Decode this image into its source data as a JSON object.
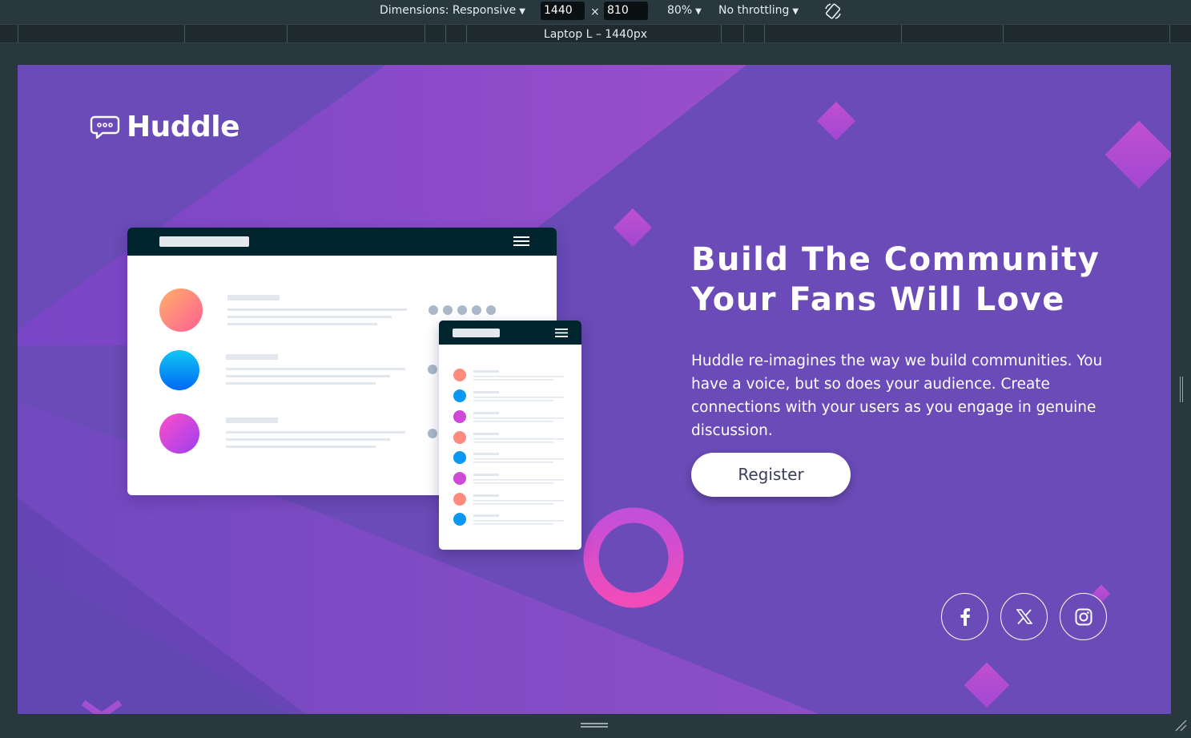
{
  "devtools": {
    "dimensions_label": "Dimensions: Responsive",
    "width_value": "1440",
    "times": "×",
    "height_value": "810",
    "zoom": "80%",
    "throttling": "No throttling",
    "device_label": "Laptop L – 1440px"
  },
  "page": {
    "brand": "Huddle",
    "headline_line1": "Build The Community",
    "headline_line2": "Your Fans Will Love",
    "description": "Huddle re-imagines the way we build communities. You have a voice, but so does your audience. Create connections with your users as you engage in genuine discussion.",
    "register_label": "Register",
    "social": [
      "facebook-icon",
      "x-icon",
      "instagram-icon"
    ]
  },
  "colors": {
    "background": "#6a4bb7",
    "accent_pink": "#d94fd6",
    "mock_bar": "#00252e",
    "white": "#ffffff"
  }
}
